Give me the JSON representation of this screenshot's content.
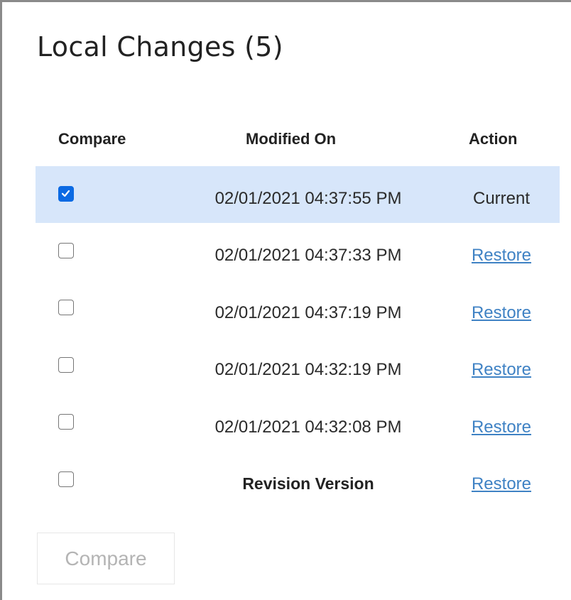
{
  "panel": {
    "title": "Local Changes (5)"
  },
  "table": {
    "headers": {
      "compare": "Compare",
      "modified_on": "Modified On",
      "action": "Action"
    },
    "rows": [
      {
        "checked": true,
        "modified_on": "02/01/2021 04:37:55 PM",
        "action": "Current",
        "action_is_link": false,
        "selected": true
      },
      {
        "checked": false,
        "modified_on": "02/01/2021 04:37:33 PM",
        "action": "Restore",
        "action_is_link": true,
        "selected": false
      },
      {
        "checked": false,
        "modified_on": "02/01/2021 04:37:19 PM",
        "action": "Restore",
        "action_is_link": true,
        "selected": false
      },
      {
        "checked": false,
        "modified_on": "02/01/2021 04:32:19 PM",
        "action": "Restore",
        "action_is_link": true,
        "selected": false
      },
      {
        "checked": false,
        "modified_on": "02/01/2021 04:32:08 PM",
        "action": "Restore",
        "action_is_link": true,
        "selected": false
      },
      {
        "checked": false,
        "modified_on": "Revision Version",
        "action": "Restore",
        "action_is_link": true,
        "selected": false
      }
    ]
  },
  "compare_button": {
    "label": "Compare",
    "disabled": true
  },
  "colors": {
    "selected_row": "#d7e6fa",
    "link": "#3f82c4",
    "checkbox_checked": "#0b6ae3",
    "disabled_text": "#b4b4b4"
  }
}
